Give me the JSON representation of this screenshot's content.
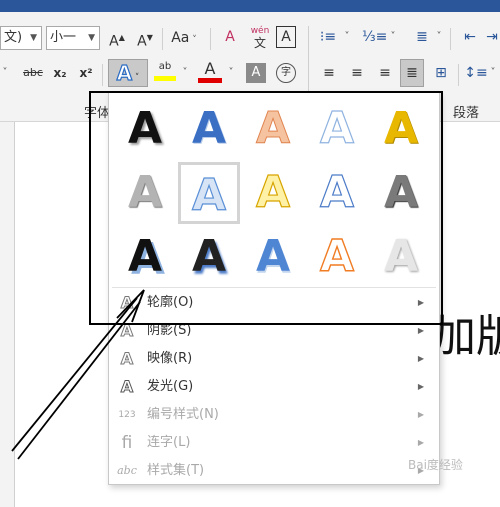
{
  "ribbon": {
    "font_name": "文)",
    "font_size": "小一",
    "grow_font": "A",
    "shrink_font": "A",
    "change_case": "Aa",
    "phonetic_top": "wén",
    "phonetic_bottom": "文",
    "char_border": "A",
    "strikethrough": "abc",
    "subscript": "x₂",
    "superscript": "x²",
    "text_effects": "A",
    "highlight_label": "ab",
    "font_color": "A",
    "char_shading": "A",
    "enclose_char": "字",
    "group_font_label": "字体",
    "group_paragraph_label": "段落",
    "colors": {
      "highlight": "#ffff00",
      "font_color": "#e00000",
      "accent": "#2b579a"
    }
  },
  "document": {
    "text": "加版"
  },
  "text_effects_menu": {
    "effects": [
      {
        "glyph": "A",
        "style": "black-shadow"
      },
      {
        "glyph": "A",
        "style": "blue-gradient"
      },
      {
        "glyph": "A",
        "style": "orange-gradient"
      },
      {
        "glyph": "A",
        "style": "light-blue-outline"
      },
      {
        "glyph": "A",
        "style": "gold-gradient"
      },
      {
        "glyph": "A",
        "style": "gray-gradient"
      },
      {
        "glyph": "A",
        "style": "blue-reflection"
      },
      {
        "glyph": "A",
        "style": "gold-outline"
      },
      {
        "glyph": "A",
        "style": "blue-outline"
      },
      {
        "glyph": "A",
        "style": "dark-gray-gradient"
      },
      {
        "glyph": "A",
        "style": "black-blue-offset"
      },
      {
        "glyph": "A",
        "style": "black-blue-shadow"
      },
      {
        "glyph": "A",
        "style": "blue-bevel"
      },
      {
        "glyph": "A",
        "style": "orange-outline"
      },
      {
        "glyph": "A",
        "style": "silver-gradient"
      }
    ],
    "items": [
      {
        "label": "轮廓(O)",
        "icon": "A",
        "enabled": true
      },
      {
        "label": "阴影(S)",
        "icon": "A",
        "enabled": true
      },
      {
        "label": "映像(R)",
        "icon": "A",
        "enabled": true
      },
      {
        "label": "发光(G)",
        "icon": "A",
        "enabled": true
      },
      {
        "label": "编号样式(N)",
        "icon": "123",
        "enabled": false
      },
      {
        "label": "连字(L)",
        "icon": "fi",
        "enabled": false
      },
      {
        "label": "样式集(T)",
        "icon": "abc",
        "enabled": false
      }
    ]
  },
  "watermark": "Bai度经验"
}
